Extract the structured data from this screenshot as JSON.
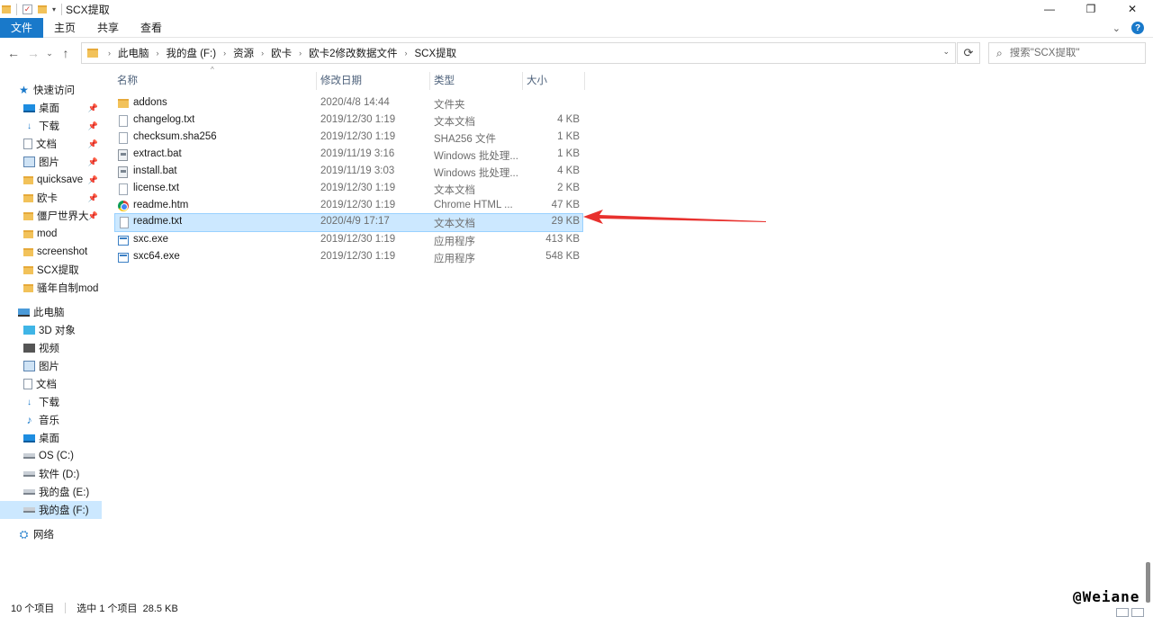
{
  "window": {
    "title": "SCX提取",
    "controls": {
      "minimize": "—",
      "maximize": "❐",
      "close": "✕"
    }
  },
  "ribbon": {
    "tabs": [
      "文件",
      "主页",
      "共享",
      "查看"
    ]
  },
  "address": {
    "crumbs": [
      "此电脑",
      "我的盘 (F:)",
      "资源",
      "欧卡",
      "欧卡2修改数据文件",
      "SCX提取"
    ],
    "search_placeholder": "搜索\"SCX提取\""
  },
  "nav": {
    "quick_access": "快速访问",
    "quick_items": [
      {
        "label": "桌面",
        "icon": "desktop-icon",
        "pinned": true
      },
      {
        "label": "下载",
        "icon": "download-icon",
        "pinned": true
      },
      {
        "label": "文档",
        "icon": "document-icon",
        "pinned": true
      },
      {
        "label": "图片",
        "icon": "picture-icon",
        "pinned": true
      },
      {
        "label": "quicksave",
        "icon": "folder-icon",
        "pinned": true
      },
      {
        "label": "欧卡",
        "icon": "folder-icon",
        "pinned": true
      },
      {
        "label": "僵尸世界大",
        "icon": "folder-icon",
        "pinned": true
      },
      {
        "label": "mod",
        "icon": "folder-icon",
        "pinned": false
      },
      {
        "label": "screenshot",
        "icon": "folder-icon",
        "pinned": false
      },
      {
        "label": "SCX提取",
        "icon": "folder-icon",
        "pinned": false
      },
      {
        "label": "骚年自制mod",
        "icon": "folder-icon",
        "pinned": false
      }
    ],
    "this_pc": "此电脑",
    "pc_items": [
      {
        "label": "3D 对象",
        "icon": "3d-objects-icon"
      },
      {
        "label": "视频",
        "icon": "video-icon"
      },
      {
        "label": "图片",
        "icon": "picture-icon"
      },
      {
        "label": "文档",
        "icon": "document-icon"
      },
      {
        "label": "下载",
        "icon": "download-icon"
      },
      {
        "label": "音乐",
        "icon": "music-icon"
      },
      {
        "label": "桌面",
        "icon": "desktop-icon"
      },
      {
        "label": "OS (C:)",
        "icon": "drive-icon"
      },
      {
        "label": "软件 (D:)",
        "icon": "drive-icon"
      },
      {
        "label": "我的盘 (E:)",
        "icon": "drive-icon"
      },
      {
        "label": "我的盘 (F:)",
        "icon": "drive-icon"
      }
    ],
    "network": "网络"
  },
  "columns": {
    "name": "名称",
    "date": "修改日期",
    "type": "类型",
    "size": "大小"
  },
  "files": [
    {
      "name": "addons",
      "date": "2020/4/8 14:44",
      "type": "文件夹",
      "size": "",
      "icon": "folder"
    },
    {
      "name": "changelog.txt",
      "date": "2019/12/30 1:19",
      "type": "文本文档",
      "size": "4 KB",
      "icon": "txt"
    },
    {
      "name": "checksum.sha256",
      "date": "2019/12/30 1:19",
      "type": "SHA256 文件",
      "size": "1 KB",
      "icon": "txt"
    },
    {
      "name": "extract.bat",
      "date": "2019/11/19 3:16",
      "type": "Windows 批处理...",
      "size": "1 KB",
      "icon": "bat"
    },
    {
      "name": "install.bat",
      "date": "2019/11/19 3:03",
      "type": "Windows 批处理...",
      "size": "4 KB",
      "icon": "bat"
    },
    {
      "name": "license.txt",
      "date": "2019/12/30 1:19",
      "type": "文本文档",
      "size": "2 KB",
      "icon": "txt"
    },
    {
      "name": "readme.htm",
      "date": "2019/12/30 1:19",
      "type": "Chrome HTML ...",
      "size": "47 KB",
      "icon": "chrome"
    },
    {
      "name": "readme.txt",
      "date": "2020/4/9 17:17",
      "type": "文本文档",
      "size": "29 KB",
      "icon": "txt",
      "selected": true
    },
    {
      "name": "sxc.exe",
      "date": "2019/12/30 1:19",
      "type": "应用程序",
      "size": "413 KB",
      "icon": "exe"
    },
    {
      "name": "sxc64.exe",
      "date": "2019/12/30 1:19",
      "type": "应用程序",
      "size": "548 KB",
      "icon": "exe"
    }
  ],
  "status": {
    "count": "10 个项目",
    "selected": "选中 1 个项目  28.5 KB"
  },
  "watermark": "@Weiane",
  "colors": {
    "accent": "#1979ca",
    "selection": "#cce8ff",
    "annotation": "#e8312e"
  }
}
